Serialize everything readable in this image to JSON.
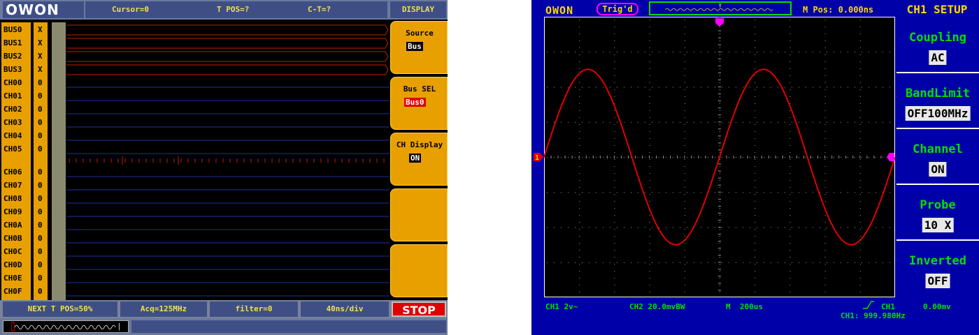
{
  "logic_analyzer": {
    "logo": "OWON",
    "top": {
      "cursor": "Cursor=0",
      "tpos": "T POS=?",
      "ct": "C-T=?",
      "menu_title": "DISPLAY"
    },
    "channels": [
      {
        "name": "BUS0",
        "val": "X"
      },
      {
        "name": "BUS1",
        "val": "X"
      },
      {
        "name": "BUS2",
        "val": "X"
      },
      {
        "name": "BUS3",
        "val": "X"
      },
      {
        "name": "CH00",
        "val": "0"
      },
      {
        "name": "CH01",
        "val": "0"
      },
      {
        "name": "CH02",
        "val": "0"
      },
      {
        "name": "CH03",
        "val": "0"
      },
      {
        "name": "CH04",
        "val": "0"
      },
      {
        "name": "CH05",
        "val": "0"
      },
      {
        "name": "CH06",
        "val": "0"
      },
      {
        "name": "CH07",
        "val": "0"
      },
      {
        "name": "CH08",
        "val": "0"
      },
      {
        "name": "CH09",
        "val": "0"
      },
      {
        "name": "CH0A",
        "val": "0"
      },
      {
        "name": "CH0B",
        "val": "0"
      },
      {
        "name": "CH0C",
        "val": "0"
      },
      {
        "name": "CH0D",
        "val": "0"
      },
      {
        "name": "CH0E",
        "val": "0"
      },
      {
        "name": "CH0F",
        "val": "0"
      }
    ],
    "menu": [
      {
        "title": "Source",
        "value": "Bus",
        "value_color": "#000000"
      },
      {
        "title": "Bus SEL",
        "value": "Bus0",
        "value_color": "#e00000"
      },
      {
        "title": "CH Display",
        "value": "ON",
        "value_color": "#000000"
      },
      {
        "title": "",
        "value": ""
      },
      {
        "title": "",
        "value": ""
      }
    ],
    "status": {
      "next_tpos": "NEXT T POS=50%",
      "acq": "Acq=125MHz",
      "filter": "filter=0",
      "timebase": "40ns/div",
      "stop": "STOP"
    },
    "colors": {
      "menu_bg": "#e8a000",
      "bus_outline": "#c02000",
      "ch_line": "#2030a0",
      "stop_bg": "#e00000"
    }
  },
  "oscilloscope": {
    "logo": "OWON",
    "trig_status": "Trig'd",
    "mpos": "M Pos: 0.000ns",
    "menu_title": "CH1 SETUP",
    "menu": [
      {
        "title": "Coupling",
        "value": "AC"
      },
      {
        "title": "BandLimit",
        "value": "OFF100MHz"
      },
      {
        "title": "Channel",
        "value": "ON"
      },
      {
        "title": "Probe",
        "value": "10 X"
      },
      {
        "title": "Inverted",
        "value": "OFF"
      }
    ],
    "status": {
      "ch1_scale": "CH1 2v~",
      "ch2_scale": "CH2 20.0mvBW",
      "timebase": "M  200us",
      "trig_source": "CH1",
      "trig_level": "0.00mv",
      "freq": "CH1: 999.980Hz"
    },
    "colors": {
      "bg": "#0000a8",
      "text": "#ffd800",
      "menu_text": "#00e000",
      "trace": "#e00000",
      "marker": "#ff00ff"
    }
  },
  "chart_data": {
    "type": "line",
    "title": "",
    "xlabel": "",
    "ylabel": "",
    "x_divisions": 10,
    "y_divisions": 8,
    "series": [
      {
        "waveform": "sine",
        "cycles_visible": 2,
        "amplitude_div": 2.5,
        "offset_div": 0,
        "start_phase": "rising-zero-crossing"
      }
    ],
    "grid": true
  }
}
